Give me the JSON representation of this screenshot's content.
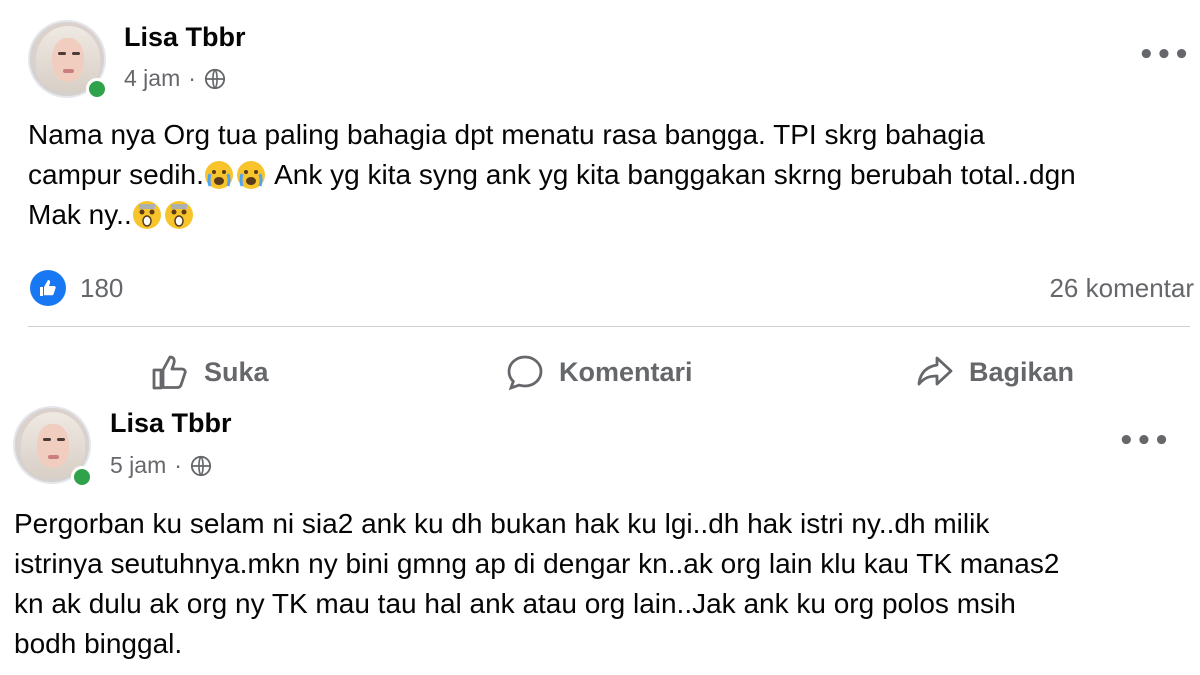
{
  "posts": [
    {
      "author": "Lisa Tbbr",
      "time": "4 jam",
      "privacy_icon": "globe-icon",
      "more_label": "•••",
      "lines": [
        "Nama nya Org tua paling bahagia dpt menatu rasa bangga. TPI skrg bahagia",
        "campur sedih.",
        "Ank yg kita syng ank yg kita banggakan skrng berubah total..dgn",
        "Mak ny.."
      ],
      "reactions": {
        "like_count": "180",
        "comments": "26 komentar"
      },
      "actions": {
        "like": "Suka",
        "comment": "Komentari",
        "share": "Bagikan"
      }
    },
    {
      "author": "Lisa Tbbr",
      "time": "5 jam",
      "privacy_icon": "globe-icon",
      "more_label": "•••",
      "lines": [
        "Pergorban ku selam ni sia2 ank ku dh bukan hak ku lgi..dh hak istri ny..dh milik",
        "istrinya seutuhnya.mkn ny bini gmng ap di dengar kn..ak org lain klu kau TK manas2",
        "kn ak dulu ak org ny TK mau tau hal ank atau org lain..Jak ank ku org polos msih",
        "bodh binggal."
      ]
    }
  ],
  "colors": {
    "accent": "#1877f2",
    "online": "#31a24c",
    "muted": "#65676b",
    "divider": "#ced0d4"
  }
}
